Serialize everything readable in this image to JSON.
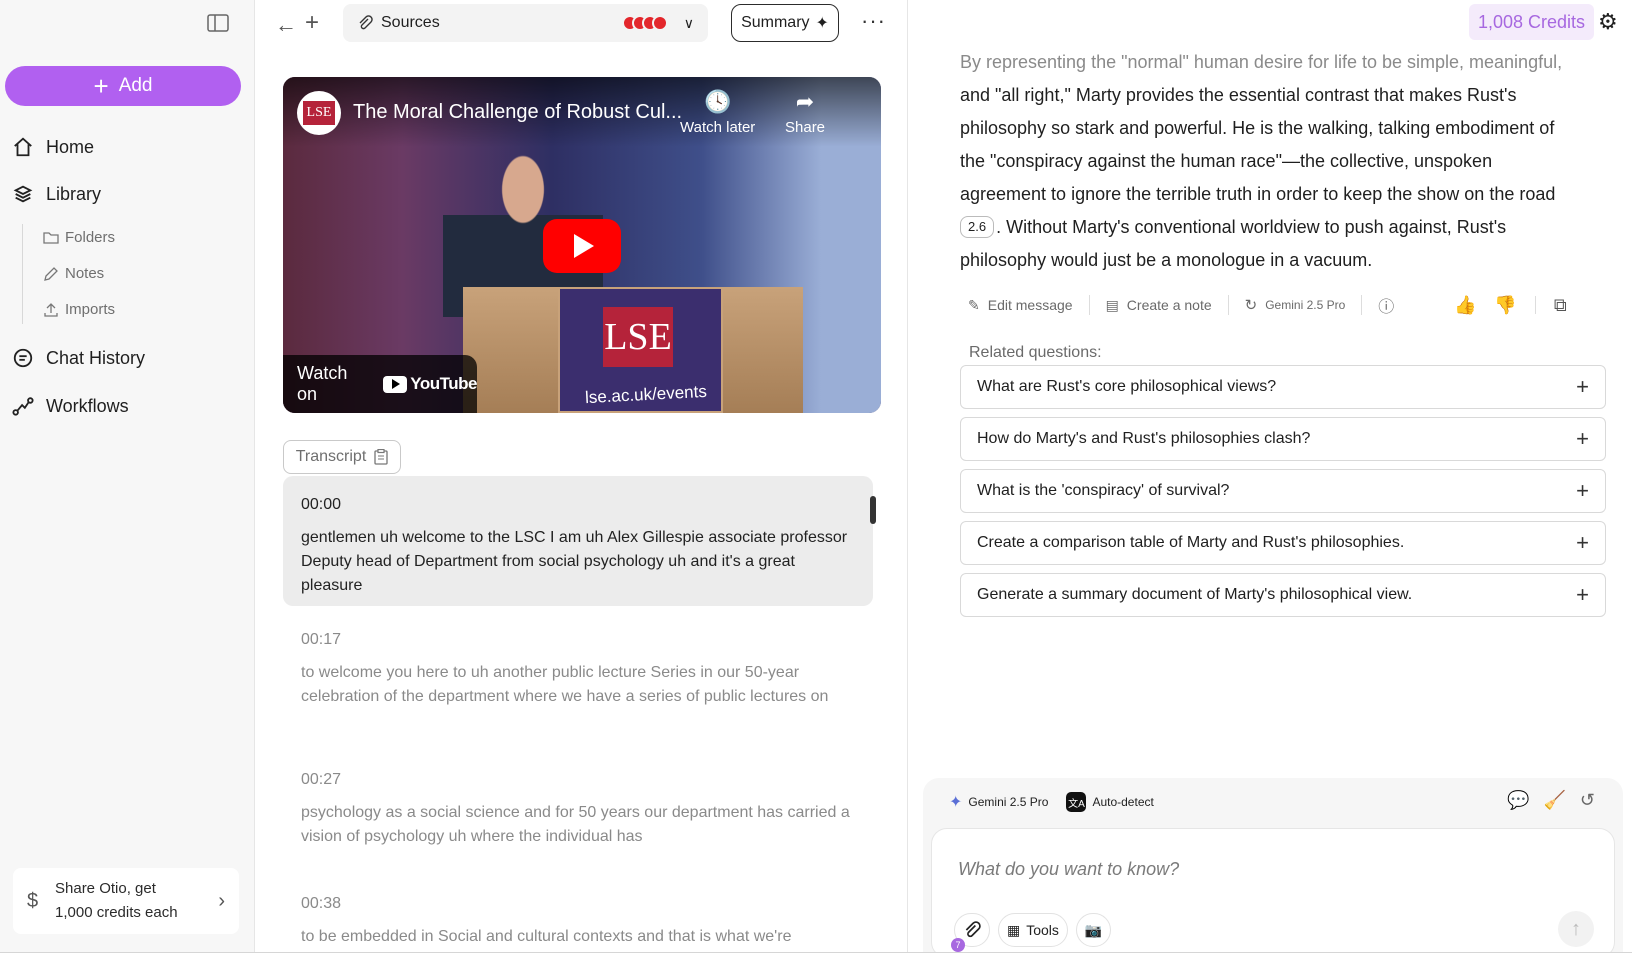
{
  "sidebar": {
    "add_label": "Add",
    "nav": [
      {
        "label": "Home",
        "icon": "home-icon"
      },
      {
        "label": "Library",
        "icon": "library-icon"
      },
      {
        "label": "Chat History",
        "icon": "chat-history-icon"
      },
      {
        "label": "Workflows",
        "icon": "workflows-icon"
      }
    ],
    "library_sub": [
      {
        "label": "Folders",
        "icon": "folder-icon"
      },
      {
        "label": "Notes",
        "icon": "pencil-icon"
      },
      {
        "label": "Imports",
        "icon": "upload-icon"
      }
    ],
    "share": {
      "line1": "Share Otio, get",
      "line2": "1,000 credits each"
    }
  },
  "topbar": {
    "sources_label": "Sources",
    "summary_label": "Summary"
  },
  "video": {
    "title": "The Moral Challenge of Robust Cul...",
    "channel_logo_text": "LSE",
    "watch_later": "Watch later",
    "share": "Share",
    "watch_on": "Watch on",
    "youtube": "YouTube",
    "url_text": "lse.ac.uk/events",
    "podium_text": "LSE"
  },
  "transcript": {
    "label": "Transcript",
    "entries": [
      {
        "time": "00:00",
        "text": "gentlemen uh welcome to the LSC I am uh Alex Gillespie associate professor Deputy head of Department from social psychology uh and it's a great pleasure"
      },
      {
        "time": "00:17",
        "text": "to welcome you here to uh another public lecture Series in our 50-year celebration of the department where we have a series of public lectures on"
      },
      {
        "time": "00:27",
        "text": "psychology as a social science and for 50 years our department has carried a vision of psychology uh where the individual has"
      },
      {
        "time": "00:38",
        "text": "to be embedded in Social and cultural contexts and that is what we're"
      }
    ]
  },
  "right": {
    "credits": "1,008 Credits",
    "answer": {
      "line1": "By representing the \"normal\" human desire for life to be simple, meaningful,",
      "body": "and \"all right,\" Marty provides the essential contrast that makes Rust's philosophy so stark and powerful. He is the walking, talking embodiment of the \"conspiracy against the human race\"—the collective, unspoken agreement to ignore the terrible truth in order to keep the show on the road",
      "citation": "2.6",
      "tail": ". Without Marty's conventional worldview to push against, Rust's philosophy would just be a monologue in a vacuum."
    },
    "actions": {
      "edit": "Edit message",
      "note": "Create a note",
      "model": "Gemini 2.5 Pro"
    },
    "related_label": "Related questions:",
    "related": [
      "What are Rust's core philosophical views?",
      "How do Marty's and Rust's philosophies clash?",
      "What is the 'conspiracy' of survival?",
      "Create a comparison table of Marty and Rust's philosophies.",
      "Generate a summary document of Marty's philosophical view."
    ],
    "composer": {
      "model": "Gemini 2.5 Pro",
      "language": "Auto-detect",
      "placeholder": "What do you want to know?",
      "tools_label": "Tools",
      "attach_badge": "7"
    }
  },
  "colors": {
    "accent": "#b160f0",
    "credits_text": "#a768e0",
    "youtube_red": "#ff0000",
    "lse_red": "#b5233a"
  }
}
